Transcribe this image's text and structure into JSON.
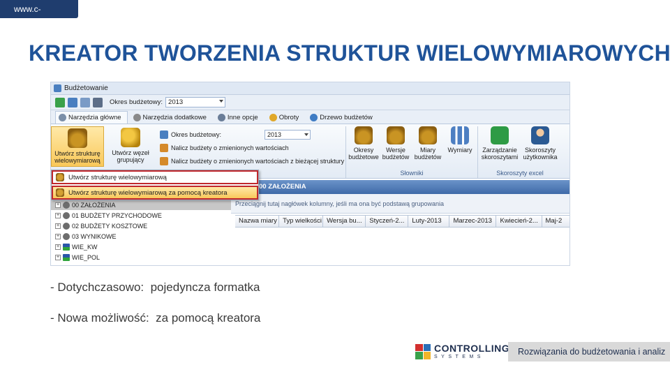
{
  "slide": {
    "url": "www.c-systems.pl",
    "title": "KREATOR TWORZENIA STRUKTUR WIELOWYMIAROWYCH",
    "bullets": [
      "- Dotychczasowo:  pojedyncza formatka",
      "- Nowa możliwość:  za pomocą kreatora"
    ],
    "logo_main": "CONTROLLING",
    "logo_sub": "SYSTEMS",
    "footer_tagline": "Rozwiązania do budżetowania i analiz"
  },
  "app": {
    "window_title": "Budżetowanie",
    "qat": {
      "okres_label": "Okres budżetowy:",
      "okres_value": "2013"
    },
    "tabs": [
      {
        "label": "Narzędzia główne",
        "active": true
      },
      {
        "label": "Narzędzia dodatkowe"
      },
      {
        "label": "Inne opcje"
      },
      {
        "label": "Obroty"
      },
      {
        "label": "Drzewo budżetów"
      }
    ],
    "ribbon": {
      "btn_utworz": "Utwórz strukturę wielowymiarową",
      "btn_wezel": "Utwórz węzeł grupujący",
      "mid": {
        "okres_label": "Okres budżetowy:",
        "okres_value": "2013",
        "nalicz1": "Nalicz budżety o zmienionych wartościach",
        "nalicz2": "Nalicz budżety o zmienionych wartościach z bieżącej struktury"
      },
      "slowniki": {
        "label": "Słowniki",
        "items": [
          "Okresy budżetowe",
          "Wersje budżetów",
          "Miary budżetów",
          "Wymiary"
        ]
      },
      "skoroszyty": {
        "label": "Skoroszyty excel",
        "items": [
          "Zarządzanie skoroszytami",
          "Skoroszyty użytkownika"
        ]
      }
    },
    "menu": [
      "Utwórz strukturę wielowymiarową",
      "Utwórz strukturę wielowymiarową za pomocą kreatora"
    ],
    "tree": [
      {
        "label": "00 ZAŁOŻENIA",
        "icon": "node"
      },
      {
        "label": "01 BUDŻETY PRZYCHODOWE",
        "icon": "node"
      },
      {
        "label": "02 BUDŻETY KOSZTOWE",
        "icon": "node"
      },
      {
        "label": "03 WYNIKOWE",
        "icon": "node"
      },
      {
        "label": "WIE_KW",
        "icon": "cube"
      },
      {
        "label": "WIE_POL",
        "icon": "cube"
      }
    ],
    "grid": {
      "header": "00 ZAŁOŻENIA",
      "group_hint": "Przeciągnij tutaj nagłówek kolumny, jeśli ma ona być podstawą grupowania",
      "columns": [
        "Nazwa miary",
        "Typ wielkości",
        "Wersja bu...",
        "Styczeń-2...",
        "Luty-2013",
        "Marzec-2013",
        "Kwiecień-2...",
        "Maj-2"
      ]
    }
  }
}
